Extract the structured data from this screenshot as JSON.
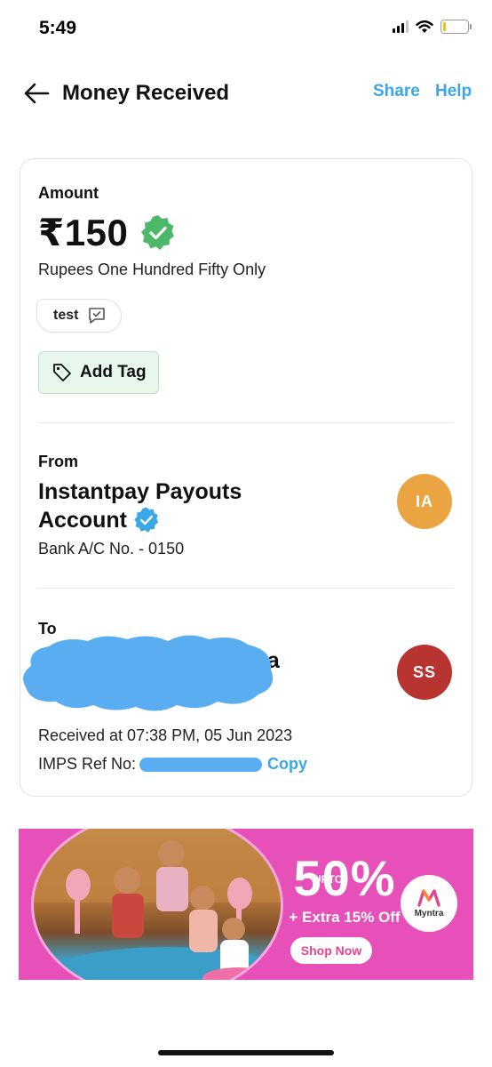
{
  "status_bar": {
    "time": "5:49"
  },
  "header": {
    "title": "Money Received",
    "share_label": "Share",
    "help_label": "Help"
  },
  "card": {
    "amount_label": "Amount",
    "amount_value": "₹150",
    "amount_words": "Rupees One Hundred Fifty Only",
    "note_text": "test",
    "add_tag_label": "Add Tag",
    "from": {
      "label": "From",
      "name_line1": "Instantpay Payouts",
      "name_line2": "Account",
      "account": "Bank A/C No. - 0150",
      "avatar_initials": "IA",
      "avatar_color": "#eaa542"
    },
    "to": {
      "label": "To",
      "name_visible": "va",
      "avatar_initials": "SS",
      "avatar_color": "#b83431"
    },
    "received_at": "Received at 07:38 PM, 05 Jun 2023",
    "imps_ref_label": "IMPS Ref No:",
    "copy_label": "Copy"
  },
  "ad": {
    "percent": "50%",
    "upto": "UPTO",
    "extra": "+ Extra 15% Off",
    "shop_now": "Shop Now",
    "brand": "Myntra"
  },
  "colors": {
    "accent_blue": "#3aa8e8",
    "verified_green": "#4cb96a",
    "verified_blue": "#3aa8e8",
    "tag_bg": "#e8f7ec",
    "ad_bg": "#e74fb9"
  }
}
